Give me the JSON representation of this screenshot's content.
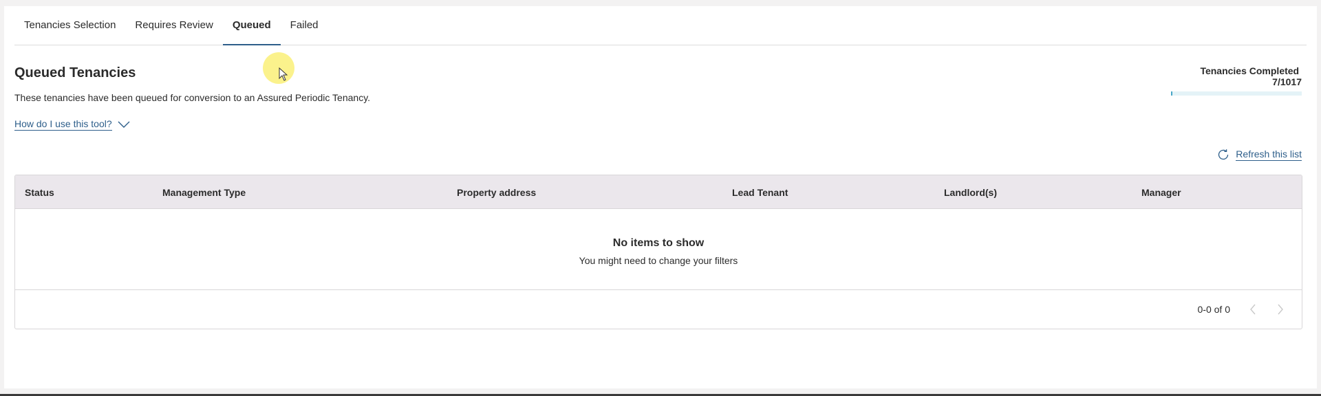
{
  "tabs": [
    {
      "label": "Tenancies Selection",
      "active": false
    },
    {
      "label": "Requires Review",
      "active": false
    },
    {
      "label": "Queued",
      "active": true
    },
    {
      "label": "Failed",
      "active": false
    }
  ],
  "header": {
    "title": "Queued Tenancies",
    "description": "These tenancies have been queued for conversion to an Assured Periodic Tenancy.",
    "help_link": "How do I use this tool?"
  },
  "progress": {
    "label": "Tenancies Completed",
    "value_text": "7/1017",
    "completed": 7,
    "total": 1017
  },
  "refresh": {
    "label": "Refresh this list",
    "icon": "refresh-icon"
  },
  "table": {
    "columns": [
      "Status",
      "Management Type",
      "Property address",
      "Lead Tenant",
      "Landlord(s)",
      "Manager"
    ],
    "empty_title": "No items to show",
    "empty_subtitle": "You might need to change your filters",
    "pagination": "0-0 of 0"
  },
  "colors": {
    "accent": "#2d5e8a",
    "progress_fill": "#48a6c8",
    "header_bg": "#ebe7ec"
  }
}
